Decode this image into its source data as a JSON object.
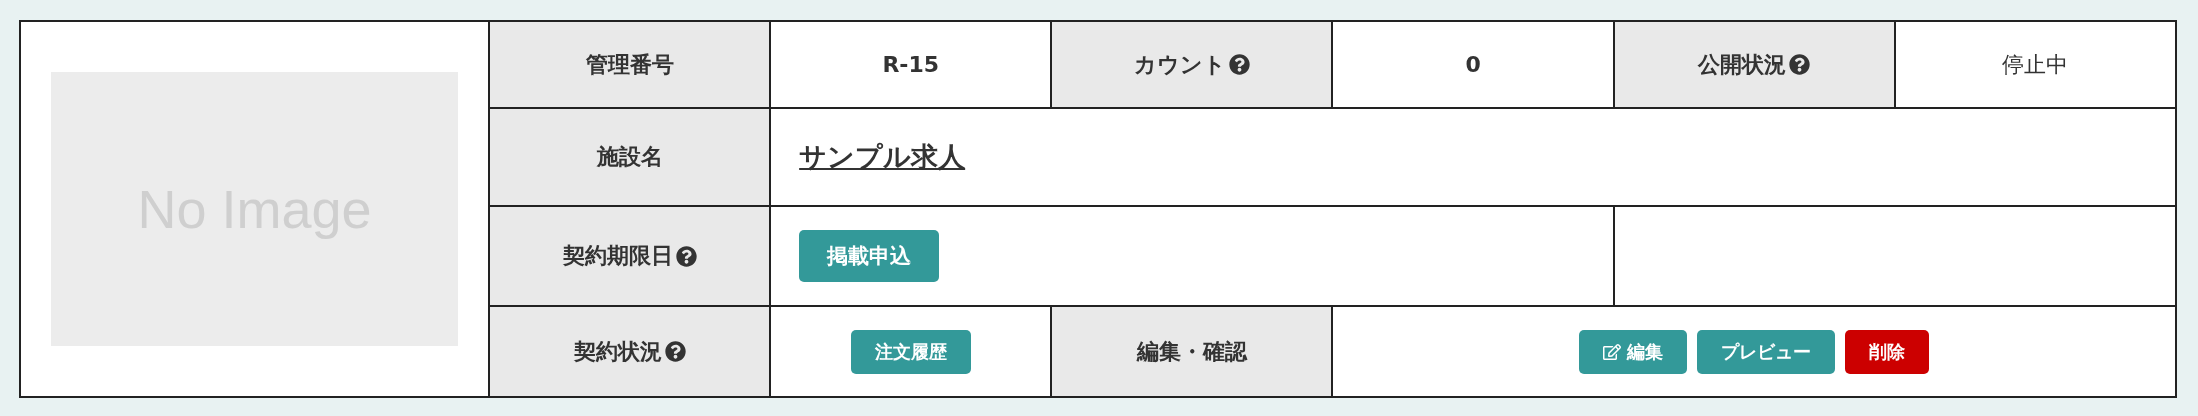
{
  "image": {
    "placeholder": "No Image"
  },
  "management_number": {
    "label": "管理番号",
    "help": false,
    "value": "R-15"
  },
  "count": {
    "label": "カウント",
    "help": true,
    "value": "0"
  },
  "publish_status": {
    "label": "公開状況",
    "help": true,
    "value": "停止中"
  },
  "facility_name": {
    "label": "施設名",
    "help": false,
    "value": "サンプル求人"
  },
  "contract_deadline": {
    "label": "契約期限日",
    "help": true,
    "button": "掲載申込"
  },
  "contract_status": {
    "label": "契約状況",
    "help": true,
    "button": "注文履歴"
  },
  "edit_confirm": {
    "label": "編集・確認",
    "help": false,
    "buttons": [
      {
        "label": "編集",
        "kind": "edit"
      },
      {
        "label": "プレビュー",
        "kind": "preview"
      },
      {
        "label": "削除",
        "kind": "delete"
      }
    ]
  }
}
